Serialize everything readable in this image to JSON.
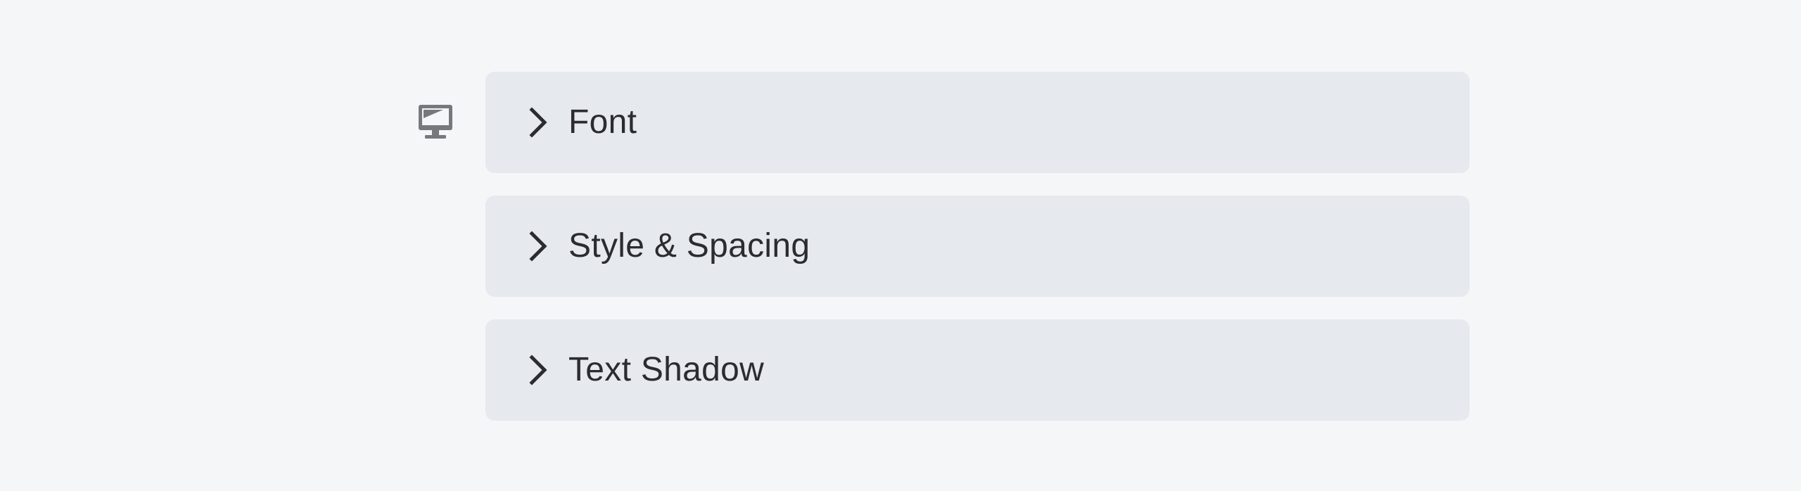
{
  "device": {
    "icon": "desktop-monitor-icon",
    "color": "#77787c"
  },
  "sections": [
    {
      "title": "Font",
      "icon": "chevron-right-icon",
      "expanded": false
    },
    {
      "title": "Style & Spacing",
      "icon": "chevron-right-icon",
      "expanded": false
    },
    {
      "title": "Text Shadow",
      "icon": "chevron-right-icon",
      "expanded": false
    }
  ],
  "colors": {
    "background": "#f5f6f8",
    "panel": "#e6e9ee",
    "text": "#2b2c30"
  }
}
